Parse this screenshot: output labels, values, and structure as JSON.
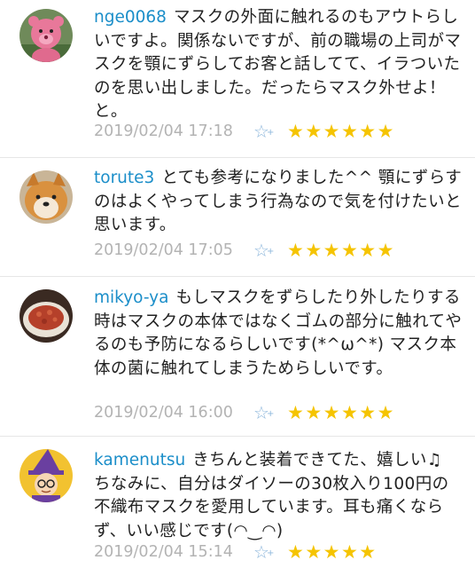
{
  "comments": [
    {
      "user": "nge0068",
      "text": "マスクの外面に触れるのもアウトらしいですよ。関係ないですが、前の職場の上司がマスクを顎にずらしてお客と話してて、イラついたのを思い出しました。だったらマスク外せよ！と。",
      "timestamp": "2019/02/04 17:18",
      "fav_icon": "star-outline-plus-icon",
      "rating": "★★★★★★"
    },
    {
      "user": "torute3",
      "text": "とても参考になりました^^ 顎にずらすのはよくやってしまう行為なので気を付けたいと思います。",
      "timestamp": "2019/02/04 17:05",
      "fav_icon": "star-outline-plus-icon",
      "rating": "★★★★★★"
    },
    {
      "user": "mikyo-ya",
      "text": "もしマスクをずらしたり外したりする時はマスクの本体ではなくゴムの部分に触れてやるのも予防になるらしいです(*^ω^*) マスク本体の菌に触れてしまうためらしいです。",
      "timestamp": "2019/02/04 16:00",
      "fav_icon": "star-outline-plus-icon",
      "rating": "★★★★★★"
    },
    {
      "user": "kamenutsu",
      "text": "きちんと装着できてた、嬉しい♫ ちなみに、自分はダイソーの30枚入り100円の不織布マスクを愛用しています。耳も痛くならず、いい感じです(◠‿◠)",
      "timestamp": "2019/02/04 15:14",
      "fav_icon": "star-outline-plus-icon",
      "rating": "★★★★★"
    }
  ],
  "colors": {
    "username": "#1b8ec9",
    "timestamp": "#b3b3b3",
    "stars": "#f5c400",
    "fav_icon": "#8fb8dc"
  }
}
